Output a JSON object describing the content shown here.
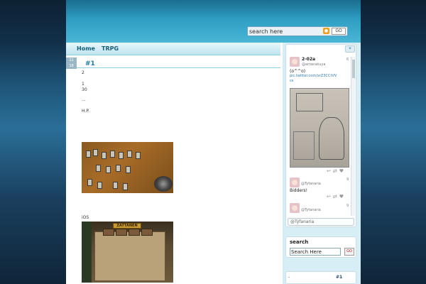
{
  "header": {
    "search_placeholder": "search here",
    "go_label": "GO"
  },
  "nav": {
    "items": [
      "Home",
      "TRPG"
    ]
  },
  "post": {
    "date_month": "11",
    "date_day": "18",
    "title": "#1",
    "lines": [
      "2",
      "1",
      "30",
      "...",
      "H.P.",
      "iOS"
    ],
    "photo2_banner": "ZATTANEN"
  },
  "twitter": {
    "tweets": [
      {
        "name": "2-02a",
        "handle": "@amanatuya",
        "num": "6",
        "text": "(o^^o)",
        "link": "pic.twitter.com/xrZ3CCtVV",
        "link2": "cs"
      },
      {
        "name": "",
        "handle": "@Tyfanaria",
        "num": "9",
        "text": "Bidders!"
      },
      {
        "name": "",
        "handle": "@Tyfanaria",
        "num": "9"
      }
    ],
    "footer_handle": "@Tyfanaria"
  },
  "search_widget": {
    "title": "search",
    "input_value": "Search Here",
    "go_label": "GO"
  },
  "bottom_widget": {
    "left": "-",
    "right": "#1"
  }
}
